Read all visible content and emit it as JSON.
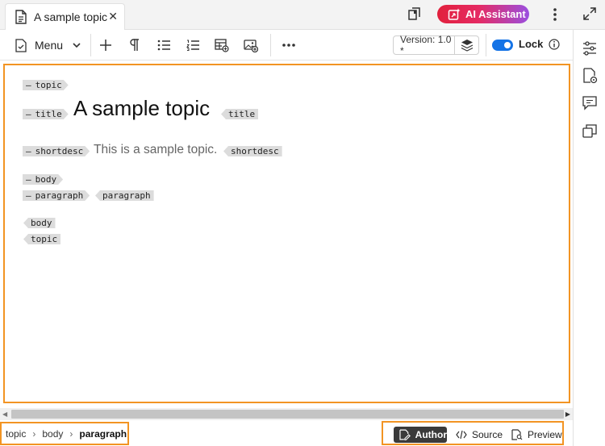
{
  "window": {
    "tab_title": "A sample topic",
    "tab_close": "✕",
    "ai_assistant": "AI Assistant"
  },
  "toolbar": {
    "menu_label": "Menu",
    "version_label": "Version: 1.0 *",
    "lock_label": "Lock",
    "lock_enabled": true
  },
  "editor": {
    "title_text": "A sample topic",
    "shortdesc_text": "This is a sample topic.",
    "tags": {
      "topic": "topic",
      "title": "title",
      "shortdesc": "shortdesc",
      "body": "body",
      "paragraph": "paragraph"
    },
    "dash": "—"
  },
  "breadcrumb": {
    "items": [
      "topic",
      "body",
      "paragraph"
    ],
    "separator": "›"
  },
  "view_modes": {
    "author": "Author",
    "source": "Source",
    "preview": "Preview",
    "active": "Author"
  },
  "colors": {
    "highlight_border": "#f29423",
    "toggle_on": "#1473e6",
    "ai_gradient_start": "#e1203c",
    "ai_gradient_end": "#9a4fe0",
    "tag_bg": "#dcdcdc",
    "active_mode_bg": "#3a3a3a"
  },
  "icons": {
    "tab": "document-icon",
    "copy": "copy-icon",
    "ai": "ai-sparkle-icon",
    "more": "more-vertical-icon",
    "expand": "expand-icon",
    "menu": "menu-document-icon",
    "insert": "plus-icon",
    "paragraph": "pilcrow-icon",
    "bullet_list": "bullet-list-icon",
    "numbered_list": "numbered-list-icon",
    "insert_table": "insert-table-icon",
    "insert_image": "insert-image-icon",
    "more_horizontal": "more-horizontal-icon",
    "version": "version-stack-icon",
    "info": "info-icon",
    "properties": "sliders-icon",
    "file_properties": "file-settings-icon",
    "comments": "comments-icon",
    "review": "copy-stack-icon"
  }
}
